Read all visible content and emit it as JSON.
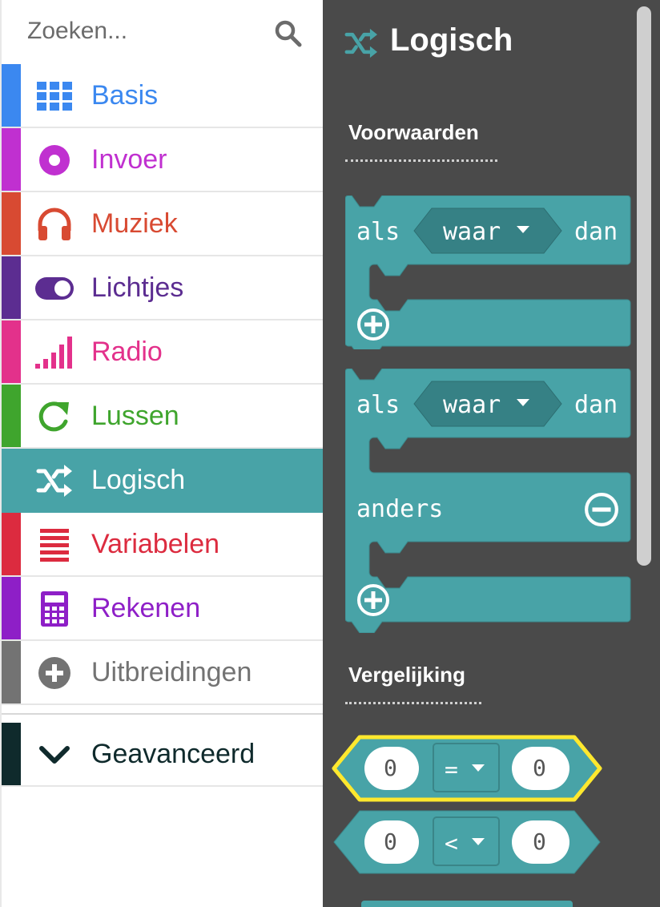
{
  "search": {
    "placeholder": "Zoeken...",
    "icon": "search-icon"
  },
  "categories": [
    {
      "label": "Basis",
      "color": "#3b88f0",
      "icon": "grid-icon"
    },
    {
      "label": "Invoer",
      "color": "#c030d0",
      "icon": "target-icon"
    },
    {
      "label": "Muziek",
      "color": "#d84a32",
      "icon": "headphones-icon"
    },
    {
      "label": "Lichtjes",
      "color": "#5c2d91",
      "icon": "toggle-icon"
    },
    {
      "label": "Radio",
      "color": "#e3318b",
      "icon": "signal-bars-icon"
    },
    {
      "label": "Lussen",
      "color": "#3fa52d",
      "icon": "refresh-icon"
    },
    {
      "label": "Logisch",
      "color": "#48a3a7",
      "icon": "shuffle-icon",
      "selected": true
    },
    {
      "label": "Variabelen",
      "color": "#dc2b3f",
      "icon": "list-lines-icon"
    },
    {
      "label": "Rekenen",
      "color": "#8e1fc7",
      "icon": "calculator-icon"
    },
    {
      "label": "Uitbreidingen",
      "color": "#737373",
      "icon": "plus-circle-icon"
    },
    {
      "label": "Geavanceerd",
      "color": "#0f2a2c",
      "icon": "chevron-down-icon"
    }
  ],
  "flyout": {
    "title": "Logisch",
    "title_icon": "shuffle-icon",
    "color": "#48a3a7",
    "sections": {
      "conditions": "Voorwaarden",
      "comparison": "Vergelijking"
    },
    "if_block": {
      "if": "als",
      "condition": "waar",
      "then": "dan"
    },
    "if_else_block": {
      "if": "als",
      "condition": "waar",
      "then": "dan",
      "else": "anders"
    },
    "compare_blocks": [
      {
        "left": "0",
        "operator": "=",
        "right": "0",
        "highlighted": true
      },
      {
        "left": "0",
        "operator": "<",
        "right": "0",
        "highlighted": false
      }
    ]
  }
}
